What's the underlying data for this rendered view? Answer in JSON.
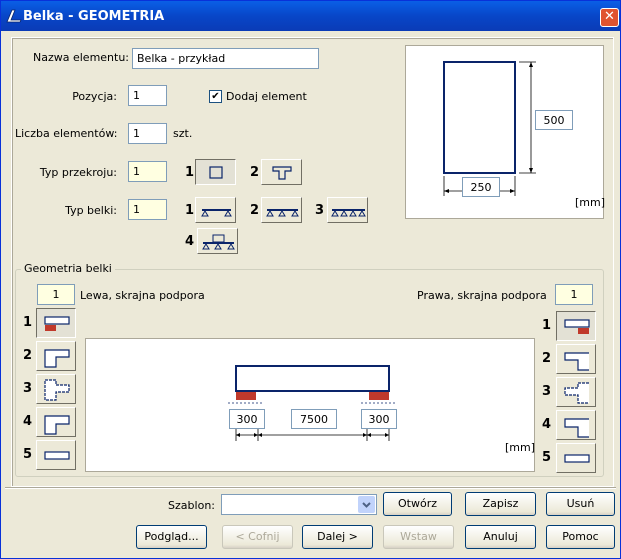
{
  "window": {
    "title": "Belka - GEOMETRIA",
    "close_label": "✕"
  },
  "form": {
    "nazwa_label": "Nazwa elementu:",
    "nazwa_value": "Belka - przykład",
    "pozycja_label": "Pozycja:",
    "pozycja_value": "1",
    "dodaj_label": "Dodaj element",
    "dodaj_checked": true,
    "liczba_label": "Liczba elementów:",
    "liczba_value": "1",
    "liczba_unit": "szt.",
    "typ_przekroju_label": "Typ przekroju:",
    "typ_przekroju_value": "1",
    "typ_belki_label": "Typ belki:",
    "typ_belki_value": "1",
    "section_options": [
      "1",
      "2"
    ],
    "beam_options": [
      "1",
      "2",
      "3",
      "4"
    ]
  },
  "section_preview": {
    "height": "500",
    "width": "250",
    "unit": "[mm]"
  },
  "geometry": {
    "group_title": "Geometria belki",
    "left_value": "1",
    "left_label": "Lewa, skrajna podpora",
    "right_label": "Prawa, skrajna podpora",
    "right_value": "1",
    "support_options": [
      "1",
      "2",
      "3",
      "4",
      "5"
    ],
    "left_support_len": "300",
    "span_len": "7500",
    "right_support_len": "300",
    "unit": "[mm]"
  },
  "footer": {
    "szablon_label": "Szablon:",
    "szablon_value": "",
    "otworz": "Otwórz",
    "zapisz": "Zapisz",
    "usun": "Usuń",
    "podglad": "Podgląd...",
    "cofnij": "< Cofnij",
    "dalej": "Dalej >",
    "wstaw": "Wstaw",
    "anuluj": "Anuluj",
    "pomoc": "Pomoc"
  },
  "colors": {
    "title_bar": "#0846c8",
    "accent": "#0a246a",
    "hatch": "#c0392b",
    "field_yellow": "#ffffe1"
  }
}
